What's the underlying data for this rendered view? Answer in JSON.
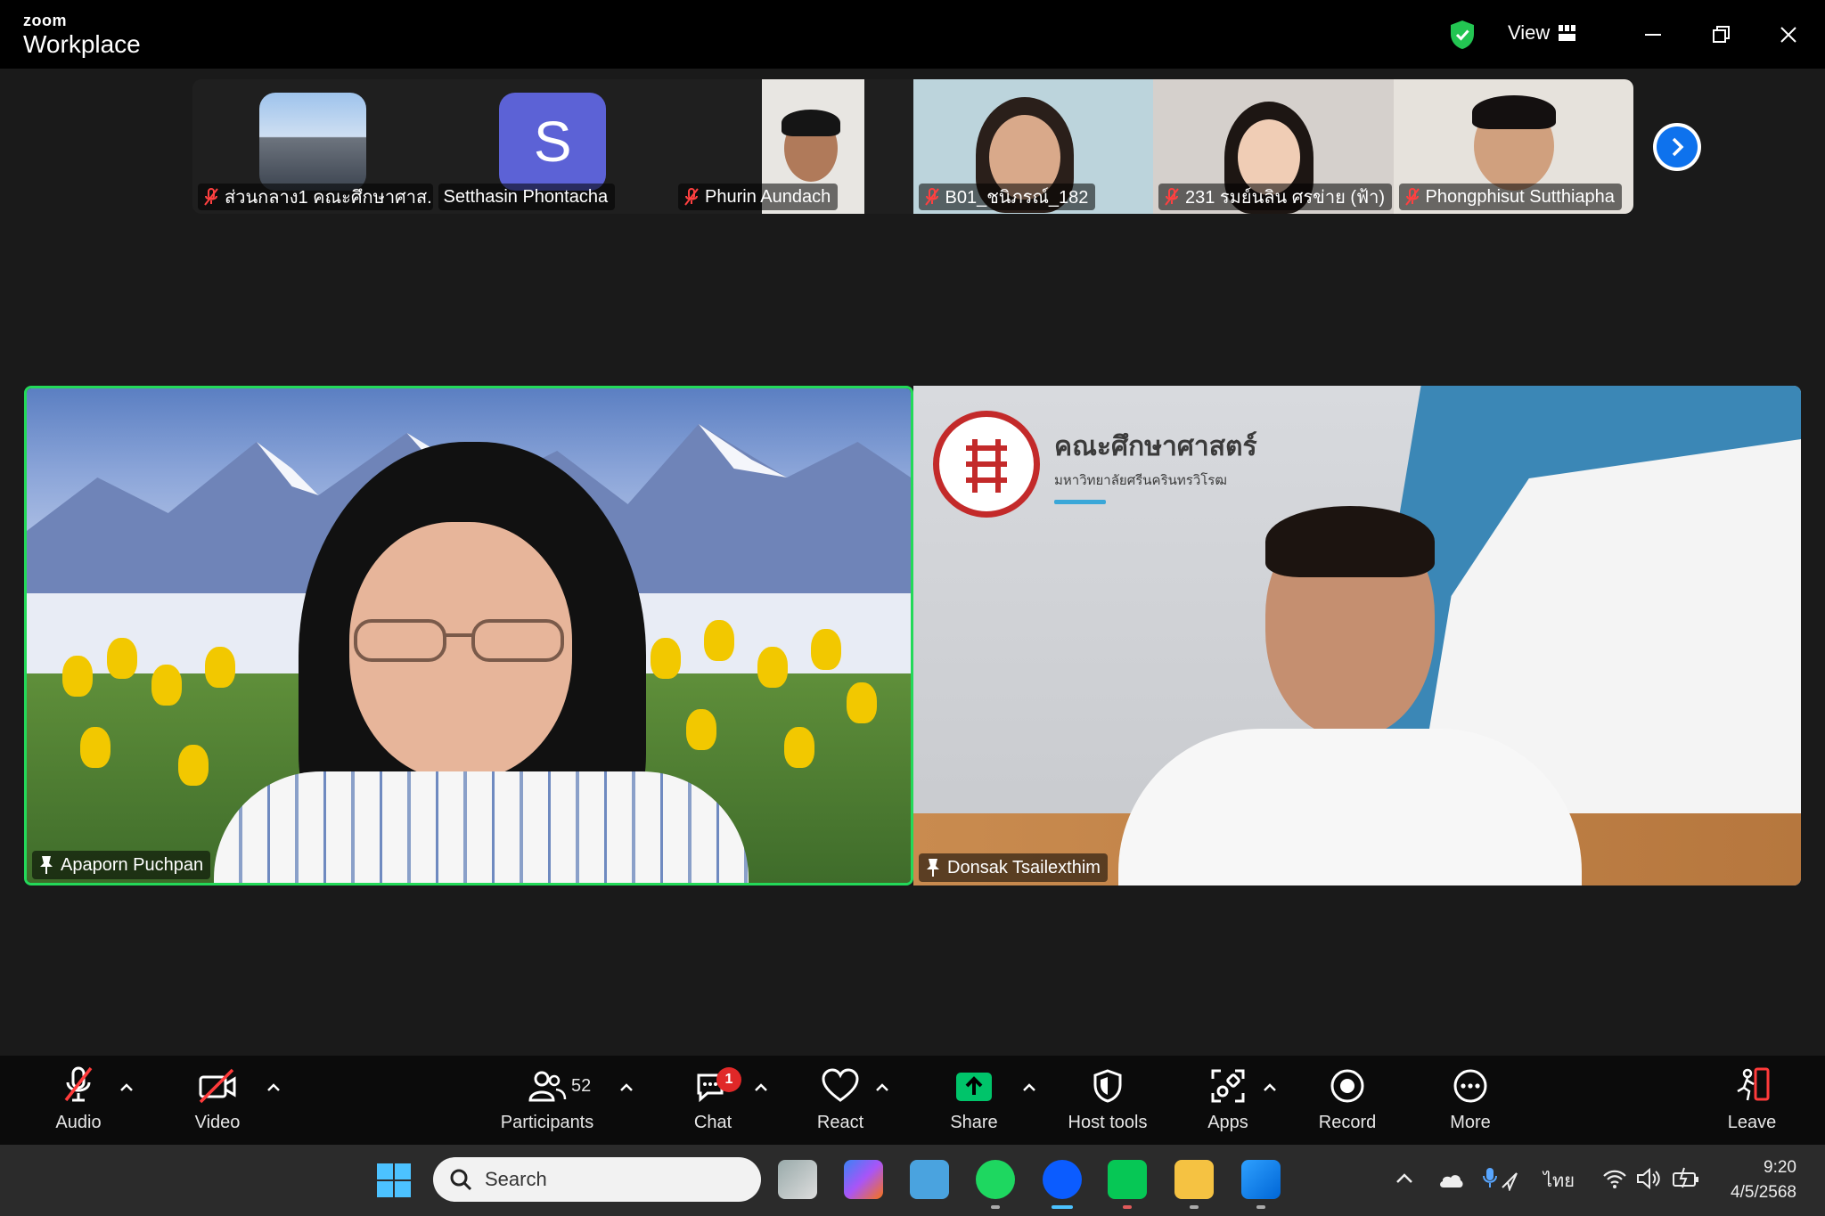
{
  "app": {
    "brand_small": "zoom",
    "brand_large": "Workplace",
    "view_label": "View"
  },
  "filmstrip": [
    {
      "name": "ส่วนกลาง1 คณะศึกษาศาส...",
      "muted": true
    },
    {
      "name": "Setthasin Phontacha",
      "muted": false,
      "initial": "S"
    },
    {
      "name": "Phurin Aundach",
      "muted": true
    },
    {
      "name": "B01_ชนิภรณ์_182",
      "muted": true
    },
    {
      "name": "231 รมย์นลิน ศรข่าย (ฟ้า)",
      "muted": true
    },
    {
      "name": "Phongphisut Sutthiapha",
      "muted": true
    }
  ],
  "main_videos": [
    {
      "name": "Apaporn Puchpan"
    },
    {
      "name": "Donsak Tsailexthim",
      "bg_title": "คณะศึกษาศาสตร์",
      "bg_subtitle": "มหาวิทยาลัยศรีนครินทรวิโรฒ"
    }
  ],
  "toolbar": {
    "audio": "Audio",
    "video": "Video",
    "participants": "Participants",
    "participants_count": "52",
    "chat": "Chat",
    "chat_badge": "1",
    "react": "React",
    "share": "Share",
    "host_tools": "Host tools",
    "apps": "Apps",
    "record": "Record",
    "more": "More",
    "leave": "Leave"
  },
  "taskbar": {
    "search_placeholder": "Search",
    "language": "ไทย",
    "time": "9:20",
    "date": "4/5/2568"
  },
  "colors": {
    "accent": "#0e72ed",
    "speaker_border": "#23d959",
    "share_green": "#00c46a",
    "muted_red": "#e02828"
  }
}
